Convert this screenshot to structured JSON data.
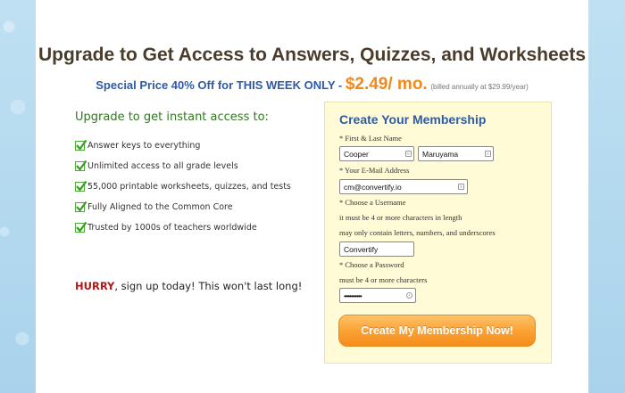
{
  "headline": "Upgrade to Get Access to Answers, Quizzes, and Worksheets",
  "subline": {
    "text": "Special Price 40% Off for THIS WEEK ONLY - ",
    "price": "$2.49/ mo.",
    "billed": "(billed annually at $29.99/year)"
  },
  "benefits": {
    "title": "Upgrade to get instant access to:",
    "items": [
      "Answer keys to everything",
      "Unlimited access to all grade levels",
      "55,000 printable worksheets, quizzes, and tests",
      "Fully Aligned to the Common Core",
      "Trusted by 1000s of teachers worldwide"
    ]
  },
  "hurry": {
    "strong": "HURRY",
    "rest": ", sign up today! This won't last long!"
  },
  "form": {
    "title": "Create Your Membership",
    "name_label": "* First & Last Name",
    "first_name": "Cooper",
    "last_name": "Maruyama",
    "email_label": "* Your E-Mail Address",
    "email": "cm@convertify.io",
    "username_label": "* Choose a Username",
    "username_hint1": "it must be 4 or more characters in length",
    "username_hint2": "may only contain letters, numbers, and underscores",
    "username": "Convertify",
    "password_label": "* Choose a Password",
    "password_hint": "must be 4 or more characters",
    "password": "••••••••••",
    "submit": "Create My Membership Now!"
  },
  "colors": {
    "headline": "#4a3c2a",
    "accent_blue": "#2e5aa8",
    "price_orange": "#f08a1c",
    "benefit_green": "#2f7a1e",
    "hurry_red": "#b01818",
    "form_bg": "#fefbd6"
  }
}
